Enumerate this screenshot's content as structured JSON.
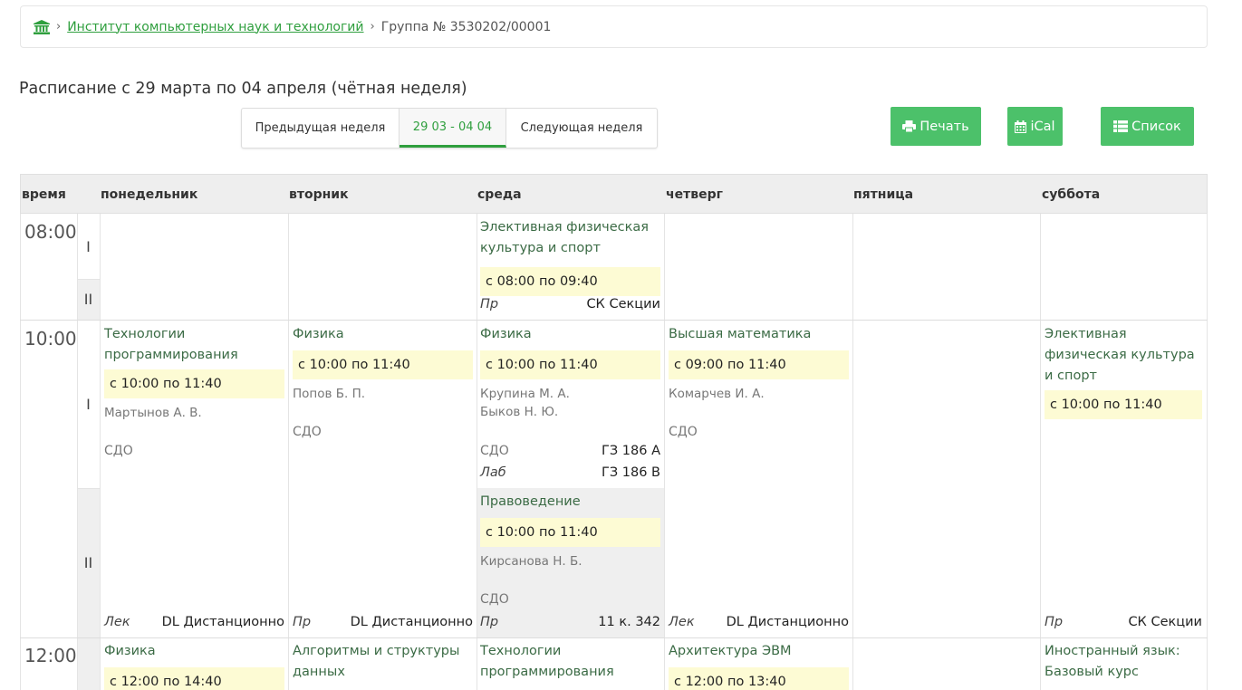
{
  "breadcrumb": {
    "institute": "Институт компьютерных наук и технологий",
    "group": "Группа № 3530202/00001"
  },
  "title": "Расписание с 29 марта по 04 апреля (чётная неделя)",
  "week_nav": {
    "prev": "Предыдущая неделя",
    "current": "29 03 - 04 04",
    "next": "Следующая неделя"
  },
  "buttons": {
    "print": "Печать",
    "ical": "iCal",
    "list": "Список"
  },
  "headers": {
    "time": "время",
    "mon": "понедельник",
    "tue": "вторник",
    "wed": "среда",
    "thu": "четверг",
    "fri": "пятница",
    "sat": "суббота"
  },
  "times": {
    "t1": "08:00",
    "t2": "10:00",
    "t3": "12:00"
  },
  "pairs": {
    "p1": "I",
    "p2": "II"
  },
  "lessons": {
    "wed_0800": {
      "subject": "Элективная физическая культура и спорт",
      "time": "с 08:00 по 09:40",
      "type": "Пр",
      "place": "СК Секции"
    },
    "mon_1000": {
      "subject": "Технологии программирования",
      "time": "с 10:00 по 11:40",
      "teacher": "Мартынов А. В.",
      "mode": "СДО",
      "type": "Лек",
      "place": "DL Дистанционно"
    },
    "tue_1000": {
      "subject": "Физика",
      "time": "с 10:00 по 11:40",
      "teacher": "Попов Б. П.",
      "mode": "СДО",
      "type": "Пр",
      "place": "DL Дистанционно"
    },
    "wed_1000": {
      "subject": "Физика",
      "time": "с 10:00 по 11:40",
      "teacher1": "Крупина М. А.",
      "teacher2": "Быков Н. Ю.",
      "mode": "СДО",
      "place1": "ГЗ 186 А",
      "type": "Лаб",
      "place2": "ГЗ 186 В"
    },
    "wed_1000b": {
      "subject": "Правоведение",
      "time": "с 10:00 по 11:40",
      "teacher": "Кирсанова Н. Б.",
      "mode": "СДО",
      "type": "Пр",
      "place": "11 к. 342"
    },
    "thu_1000": {
      "subject": "Высшая математика",
      "time": "с 09:00 по 11:40",
      "teacher": "Комарчев И. А.",
      "mode": "СДО",
      "type": "Лек",
      "place": "DL Дистанционно"
    },
    "sat_1000": {
      "subject": "Элективная физическая культура и спорт",
      "time": "с 10:00 по 11:40",
      "type": "Пр",
      "place": "СК Секции"
    },
    "mon_1200": {
      "subject": "Физика",
      "time": "с 12:00 по 14:40"
    },
    "tue_1200": {
      "subject": "Алгоритмы и структуры данных"
    },
    "wed_1200": {
      "subject": "Технологии программирования"
    },
    "thu_1200": {
      "subject": "Архитектура ЭВМ",
      "time": "с 12:00 по 13:40"
    },
    "sat_1200": {
      "subject": "Иностранный язык: Базовый курс"
    }
  },
  "colors": {
    "accent": "#2f9f3e",
    "button": "#4cc16a",
    "time_bg": "#fdfbd4"
  },
  "icons": {
    "home": "institution-icon",
    "print": "print-icon",
    "ical": "calendar-icon",
    "list": "list-icon"
  }
}
